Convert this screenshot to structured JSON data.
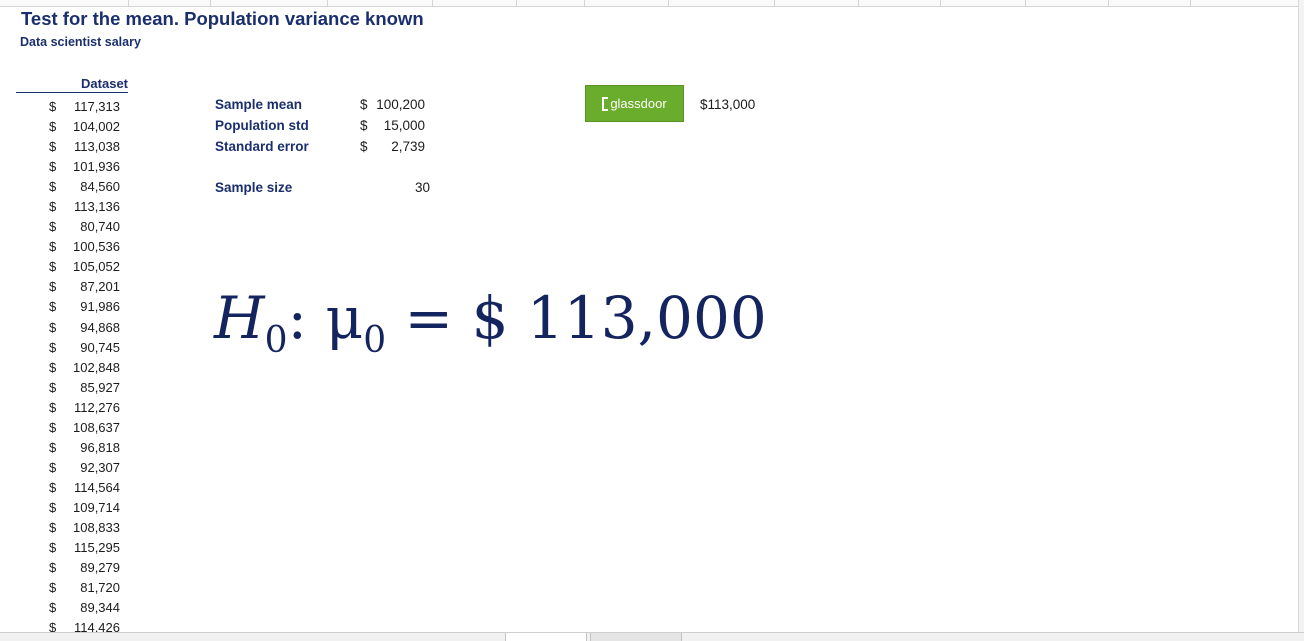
{
  "title": "Test for the mean. Population variance known",
  "subtitle": "Data scientist salary",
  "dataset": {
    "header": "Dataset",
    "currency_symbol": "$",
    "values": [
      "117,313",
      "104,002",
      "113,038",
      "101,936",
      "84,560",
      "113,136",
      "80,740",
      "100,536",
      "105,052",
      "87,201",
      "91,986",
      "94,868",
      "90,745",
      "102,848",
      "85,927",
      "112,276",
      "108,637",
      "96,818",
      "92,307",
      "114,564",
      "109,714",
      "108,833",
      "115,295",
      "89,279",
      "81,720",
      "89,344",
      "114,426"
    ]
  },
  "stats": {
    "sample_mean": {
      "label": "Sample mean",
      "symbol": "$",
      "value": "100,200"
    },
    "population_std": {
      "label": "Population std",
      "symbol": "$",
      "value": "15,000"
    },
    "standard_error": {
      "label": "Standard error",
      "symbol": "$",
      "value": "2,739"
    },
    "sample_size": {
      "label": "Sample size",
      "value": "30"
    }
  },
  "glassdoor": {
    "logo_text": "glassdoor",
    "value": "$113,000",
    "brand_color": "#6aac2b"
  },
  "hypothesis": {
    "h": "H",
    "h_sub": "0",
    "colon": ":",
    "mu": "μ",
    "mu_sub": "0",
    "rest": "= $ 113,000"
  }
}
